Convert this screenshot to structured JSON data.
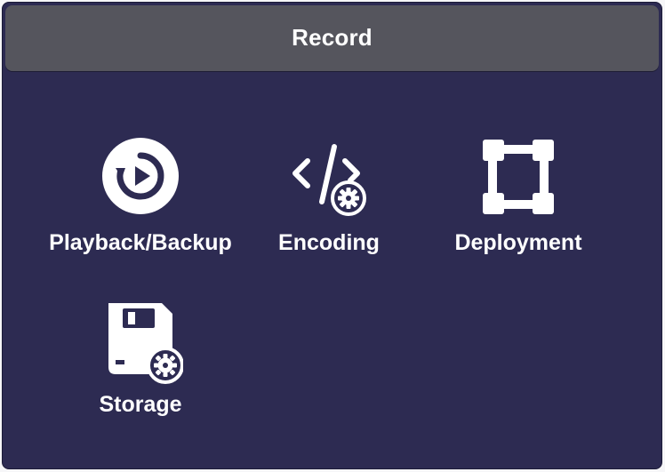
{
  "window": {
    "title": "Record"
  },
  "tiles": [
    {
      "label": "Playback/Backup",
      "icon": "playback-icon"
    },
    {
      "label": "Encoding",
      "icon": "encoding-icon"
    },
    {
      "label": "Deployment",
      "icon": "deployment-icon"
    },
    {
      "label": "Storage",
      "icon": "storage-icon"
    }
  ],
  "colors": {
    "background": "#2d2b52",
    "titlebar": "#55555d",
    "text": "#ffffff"
  }
}
